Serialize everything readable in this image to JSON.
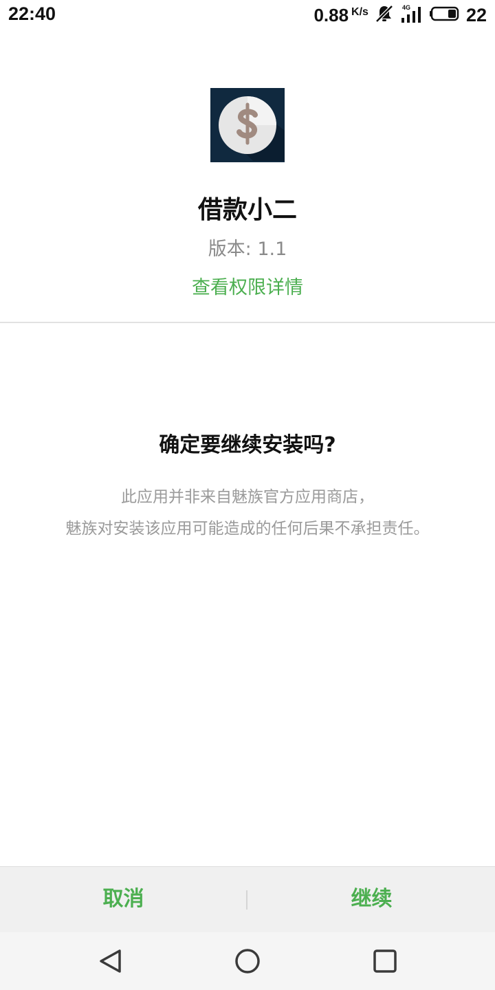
{
  "status_bar": {
    "time": "22:40",
    "net_speed": "0.88",
    "net_speed_unit": "K/s",
    "network_type": "4G",
    "battery_level": "22",
    "icons": [
      "mute-bell-icon",
      "signal-icon",
      "battery-icon"
    ]
  },
  "app": {
    "icon": "dollar-coin-icon",
    "name": "借款小二",
    "version": "版本: 1.1",
    "permissions_link": "查看权限详情"
  },
  "dialog": {
    "title": "确定要继续安装吗?",
    "message_line1": "此应用并非来自魅族官方应用商店，",
    "message_line2": "魅族对安装该应用可能造成的任何后果不承担责任。"
  },
  "actions": {
    "cancel": "取消",
    "continue": "继续"
  },
  "navigation": {
    "icons": [
      "back-icon",
      "home-icon",
      "recents-icon"
    ]
  },
  "colors": {
    "accent": "#4caf50",
    "icon_background": "#10293f",
    "secondary_text": "#9a9a9a"
  }
}
